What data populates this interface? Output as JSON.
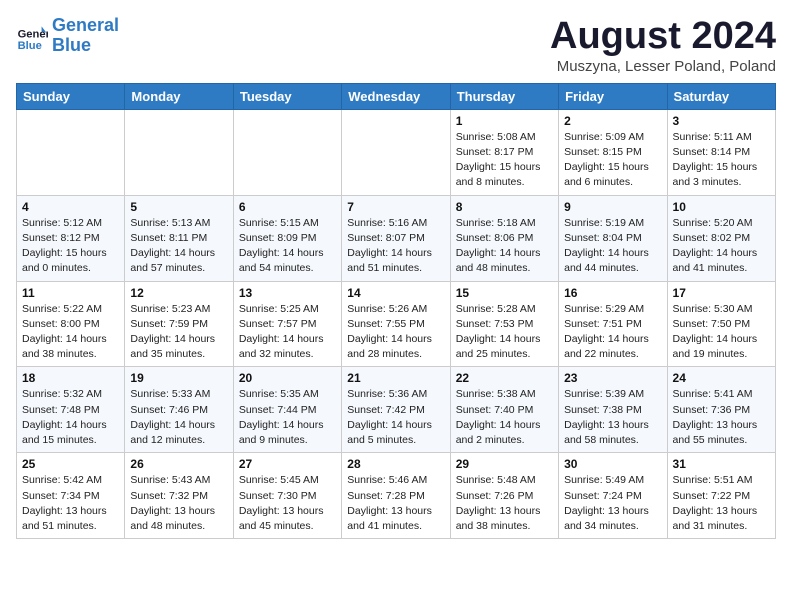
{
  "header": {
    "logo_line1": "General",
    "logo_line2": "Blue",
    "month_title": "August 2024",
    "location": "Muszyna, Lesser Poland, Poland"
  },
  "weekdays": [
    "Sunday",
    "Monday",
    "Tuesday",
    "Wednesday",
    "Thursday",
    "Friday",
    "Saturday"
  ],
  "weeks": [
    [
      {
        "day": "",
        "info": ""
      },
      {
        "day": "",
        "info": ""
      },
      {
        "day": "",
        "info": ""
      },
      {
        "day": "",
        "info": ""
      },
      {
        "day": "1",
        "info": "Sunrise: 5:08 AM\nSunset: 8:17 PM\nDaylight: 15 hours\nand 8 minutes."
      },
      {
        "day": "2",
        "info": "Sunrise: 5:09 AM\nSunset: 8:15 PM\nDaylight: 15 hours\nand 6 minutes."
      },
      {
        "day": "3",
        "info": "Sunrise: 5:11 AM\nSunset: 8:14 PM\nDaylight: 15 hours\nand 3 minutes."
      }
    ],
    [
      {
        "day": "4",
        "info": "Sunrise: 5:12 AM\nSunset: 8:12 PM\nDaylight: 15 hours\nand 0 minutes."
      },
      {
        "day": "5",
        "info": "Sunrise: 5:13 AM\nSunset: 8:11 PM\nDaylight: 14 hours\nand 57 minutes."
      },
      {
        "day": "6",
        "info": "Sunrise: 5:15 AM\nSunset: 8:09 PM\nDaylight: 14 hours\nand 54 minutes."
      },
      {
        "day": "7",
        "info": "Sunrise: 5:16 AM\nSunset: 8:07 PM\nDaylight: 14 hours\nand 51 minutes."
      },
      {
        "day": "8",
        "info": "Sunrise: 5:18 AM\nSunset: 8:06 PM\nDaylight: 14 hours\nand 48 minutes."
      },
      {
        "day": "9",
        "info": "Sunrise: 5:19 AM\nSunset: 8:04 PM\nDaylight: 14 hours\nand 44 minutes."
      },
      {
        "day": "10",
        "info": "Sunrise: 5:20 AM\nSunset: 8:02 PM\nDaylight: 14 hours\nand 41 minutes."
      }
    ],
    [
      {
        "day": "11",
        "info": "Sunrise: 5:22 AM\nSunset: 8:00 PM\nDaylight: 14 hours\nand 38 minutes."
      },
      {
        "day": "12",
        "info": "Sunrise: 5:23 AM\nSunset: 7:59 PM\nDaylight: 14 hours\nand 35 minutes."
      },
      {
        "day": "13",
        "info": "Sunrise: 5:25 AM\nSunset: 7:57 PM\nDaylight: 14 hours\nand 32 minutes."
      },
      {
        "day": "14",
        "info": "Sunrise: 5:26 AM\nSunset: 7:55 PM\nDaylight: 14 hours\nand 28 minutes."
      },
      {
        "day": "15",
        "info": "Sunrise: 5:28 AM\nSunset: 7:53 PM\nDaylight: 14 hours\nand 25 minutes."
      },
      {
        "day": "16",
        "info": "Sunrise: 5:29 AM\nSunset: 7:51 PM\nDaylight: 14 hours\nand 22 minutes."
      },
      {
        "day": "17",
        "info": "Sunrise: 5:30 AM\nSunset: 7:50 PM\nDaylight: 14 hours\nand 19 minutes."
      }
    ],
    [
      {
        "day": "18",
        "info": "Sunrise: 5:32 AM\nSunset: 7:48 PM\nDaylight: 14 hours\nand 15 minutes."
      },
      {
        "day": "19",
        "info": "Sunrise: 5:33 AM\nSunset: 7:46 PM\nDaylight: 14 hours\nand 12 minutes."
      },
      {
        "day": "20",
        "info": "Sunrise: 5:35 AM\nSunset: 7:44 PM\nDaylight: 14 hours\nand 9 minutes."
      },
      {
        "day": "21",
        "info": "Sunrise: 5:36 AM\nSunset: 7:42 PM\nDaylight: 14 hours\nand 5 minutes."
      },
      {
        "day": "22",
        "info": "Sunrise: 5:38 AM\nSunset: 7:40 PM\nDaylight: 14 hours\nand 2 minutes."
      },
      {
        "day": "23",
        "info": "Sunrise: 5:39 AM\nSunset: 7:38 PM\nDaylight: 13 hours\nand 58 minutes."
      },
      {
        "day": "24",
        "info": "Sunrise: 5:41 AM\nSunset: 7:36 PM\nDaylight: 13 hours\nand 55 minutes."
      }
    ],
    [
      {
        "day": "25",
        "info": "Sunrise: 5:42 AM\nSunset: 7:34 PM\nDaylight: 13 hours\nand 51 minutes."
      },
      {
        "day": "26",
        "info": "Sunrise: 5:43 AM\nSunset: 7:32 PM\nDaylight: 13 hours\nand 48 minutes."
      },
      {
        "day": "27",
        "info": "Sunrise: 5:45 AM\nSunset: 7:30 PM\nDaylight: 13 hours\nand 45 minutes."
      },
      {
        "day": "28",
        "info": "Sunrise: 5:46 AM\nSunset: 7:28 PM\nDaylight: 13 hours\nand 41 minutes."
      },
      {
        "day": "29",
        "info": "Sunrise: 5:48 AM\nSunset: 7:26 PM\nDaylight: 13 hours\nand 38 minutes."
      },
      {
        "day": "30",
        "info": "Sunrise: 5:49 AM\nSunset: 7:24 PM\nDaylight: 13 hours\nand 34 minutes."
      },
      {
        "day": "31",
        "info": "Sunrise: 5:51 AM\nSunset: 7:22 PM\nDaylight: 13 hours\nand 31 minutes."
      }
    ]
  ]
}
